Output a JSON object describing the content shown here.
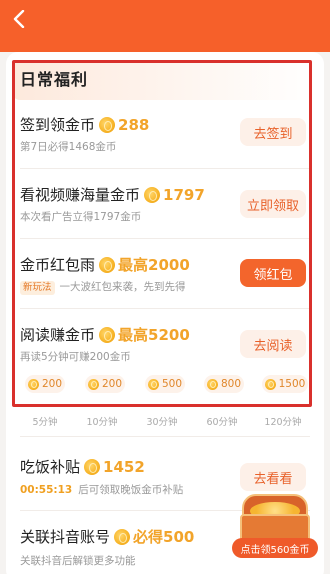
{
  "header": {
    "back_label": "<"
  },
  "section": {
    "title": "日常福利"
  },
  "tasks": [
    {
      "title": "签到领金币",
      "reward": "288",
      "desc": "第7日必得1468金币",
      "button": "去签到",
      "primary": false
    },
    {
      "title": "看视频赚海量金币",
      "reward": "1797",
      "desc": "本次看广告立得1797金币",
      "button": "立即领取",
      "primary": false
    },
    {
      "title": "金币红包雨",
      "reward": "最高2000",
      "tag": "新玩法",
      "desc": "一大波红包来袭，先到先得",
      "button": "领红包",
      "primary": true
    },
    {
      "title": "阅读赚金币",
      "reward": "最高5200",
      "desc": "再读5分钟可赚200金币",
      "button": "去阅读",
      "primary": false
    },
    {
      "title": "吃饭补贴",
      "reward": "1452",
      "timer": "00:55:13",
      "desc": "后可领取晚饭金币补贴",
      "button": "去看看",
      "primary": false
    },
    {
      "title": "关联抖音账号",
      "reward": "必得500",
      "desc": "关联抖音后解锁更多功能"
    }
  ],
  "reading_milestones": [
    {
      "coins": "200",
      "time": "5分钟"
    },
    {
      "coins": "200",
      "time": "10分钟"
    },
    {
      "coins": "500",
      "time": "30分钟"
    },
    {
      "coins": "800",
      "time": "60分钟"
    },
    {
      "coins": "1500",
      "time": "120分钟"
    }
  ],
  "promo": {
    "label": "点击领560金币"
  },
  "icons": [
    "back-arrow-icon",
    "coin-icon",
    "treasure-chest-icon"
  ],
  "colors": {
    "brand": "#f6602a",
    "reward": "#f2a42a",
    "highlight_box": "#d9302c"
  }
}
